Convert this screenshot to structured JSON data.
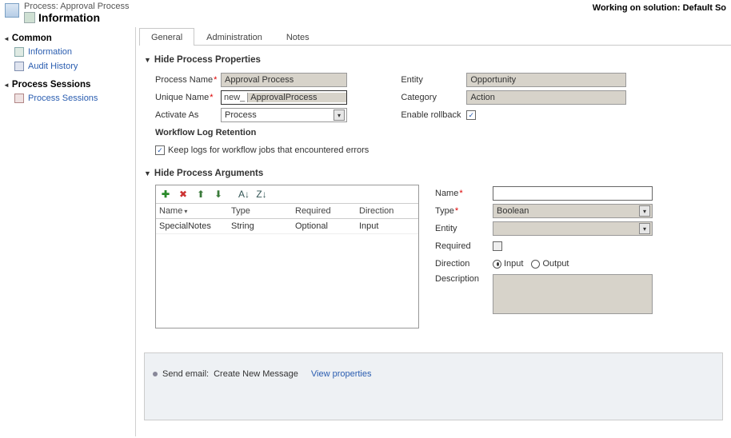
{
  "header": {
    "title_line1": "Process: Approval Process",
    "title_line2": "Information",
    "working_on": "Working on solution: Default So"
  },
  "sidebar": {
    "section1": "Common",
    "item_information": "Information",
    "item_audit": "Audit History",
    "section2": "Process Sessions",
    "item_sessions": "Process Sessions"
  },
  "tabs": {
    "general": "General",
    "admin": "Administration",
    "notes": "Notes"
  },
  "section_props": "Hide Process Properties",
  "props": {
    "process_name_lbl": "Process Name",
    "process_name_val": "Approval Process",
    "unique_name_lbl": "Unique Name",
    "unique_prefix": "new_",
    "unique_val": "ApprovalProcess",
    "activate_as_lbl": "Activate As",
    "activate_as_val": "Process",
    "entity_lbl": "Entity",
    "entity_val": "Opportunity",
    "category_lbl": "Category",
    "category_val": "Action",
    "rollback_lbl": "Enable rollback",
    "wf_log_title": "Workflow Log Retention",
    "wf_log_chk": "Keep logs for workflow jobs that encountered errors"
  },
  "section_args": "Hide Process Arguments",
  "grid": {
    "col_name": "Name",
    "col_type": "Type",
    "col_req": "Required",
    "col_dir": "Direction",
    "row1": {
      "name": "SpecialNotes",
      "type": "String",
      "req": "Optional",
      "dir": "Input"
    }
  },
  "argform": {
    "name_lbl": "Name",
    "type_lbl": "Type",
    "type_val": "Boolean",
    "entity_lbl": "Entity",
    "required_lbl": "Required",
    "direction_lbl": "Direction",
    "dir_input": "Input",
    "dir_output": "Output",
    "desc_lbl": "Description"
  },
  "bottom": {
    "step_prefix": "Send email:",
    "step_name": "Create New Message",
    "view_props": "View properties"
  }
}
